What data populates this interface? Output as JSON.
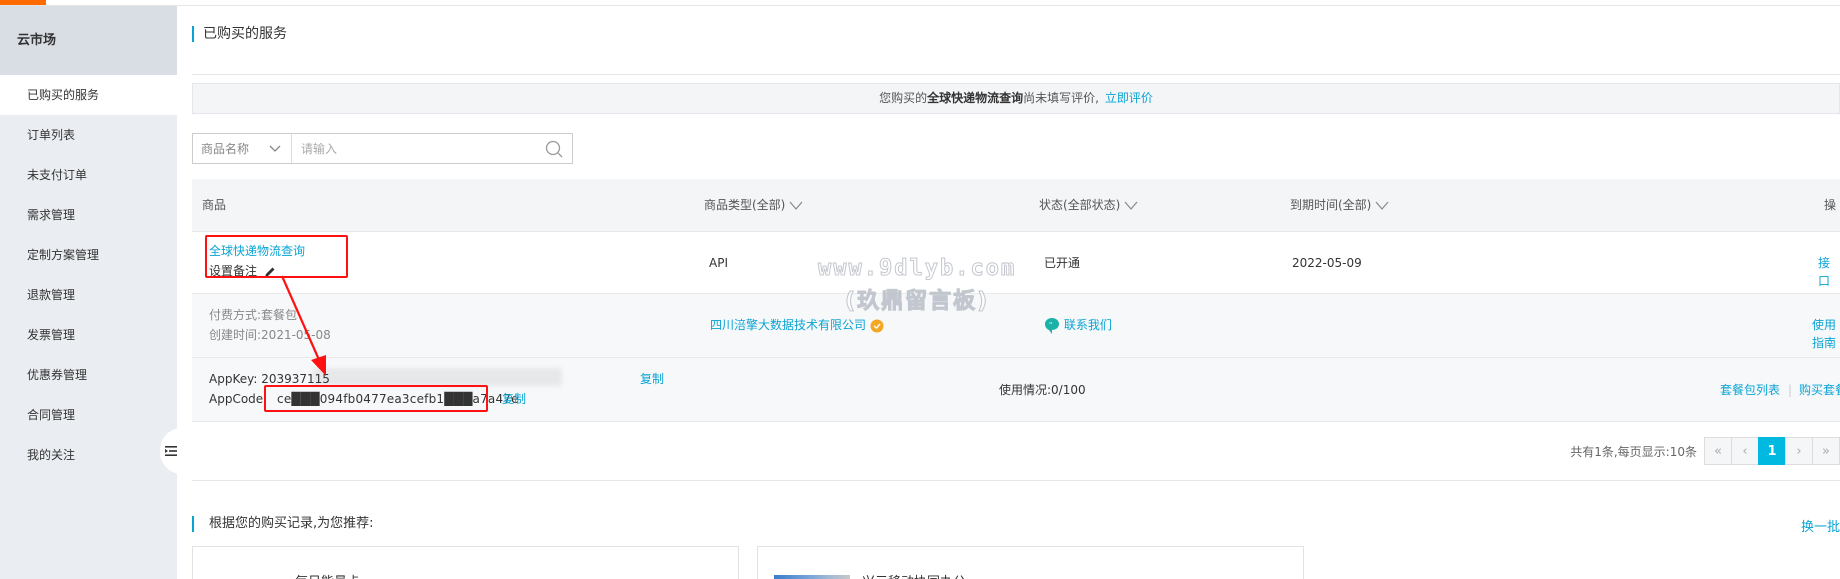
{
  "colors": {
    "accent": "#0aa4d4",
    "brand_orange": "#ff6a00",
    "highlight_red": "#ff1111",
    "pager_active": "#00b9e1"
  },
  "sidebar": {
    "title": "云市场",
    "items": [
      {
        "label": "已购买的服务",
        "active": true
      },
      {
        "label": "订单列表"
      },
      {
        "label": "未支付订单"
      },
      {
        "label": "需求管理"
      },
      {
        "label": "定制方案管理"
      },
      {
        "label": "退款管理"
      },
      {
        "label": "发票管理"
      },
      {
        "label": "优惠券管理"
      },
      {
        "label": "合同管理"
      },
      {
        "label": "我的关注"
      }
    ],
    "collapse_icon": "menu-collapse-icon"
  },
  "page": {
    "title": "已购买的服务"
  },
  "notice": {
    "prefix": "您购买的",
    "product": "全球快递物流查询",
    "suffix": "尚未填写评价,",
    "link": "立即评价"
  },
  "search": {
    "select_value": "商品名称",
    "placeholder": "请输入",
    "icon": "search-icon"
  },
  "table": {
    "headers": {
      "product": "商品",
      "type": "商品类型(全部)",
      "status": "状态(全部状态)",
      "expire": "到期时间(全部)",
      "action": "操"
    },
    "row": {
      "product_name": "全球快递物流查询",
      "remark": "设置备注",
      "type": "API",
      "status": "已开通",
      "expire_date": "2022-05-09",
      "action_link": "接口",
      "pay_method": "付费方式:套餐包",
      "created": "创建时间:2021-05-08",
      "vendor": "四川涪擎大数据技术有限公司",
      "contact": "联系我们",
      "guide": "使用指南",
      "appkey_label": "AppKey:",
      "appkey_value": "203937115",
      "appcode_label": "AppCode:",
      "appcode_value": "ce███094fb0477ea3cefb1███a7a47e",
      "copy": "复制",
      "usage": "使用情况:0/100",
      "package_list": "套餐包列表",
      "buy_package": "购买套餐包"
    }
  },
  "pager": {
    "total": "共有1条,每页显示:10条",
    "first": "«",
    "prev": "‹",
    "current": "1",
    "next": "›",
    "last": "»"
  },
  "recommend": {
    "title": "根据您的购买记录,为您推荐:",
    "switch": "换一批",
    "cards": [
      {
        "name": "每日能量卡"
      },
      {
        "name": "兴元移动协同办公"
      }
    ]
  },
  "watermark": {
    "line1": "www.9dlyb.com",
    "line2": "(玖鼎留言板)"
  }
}
